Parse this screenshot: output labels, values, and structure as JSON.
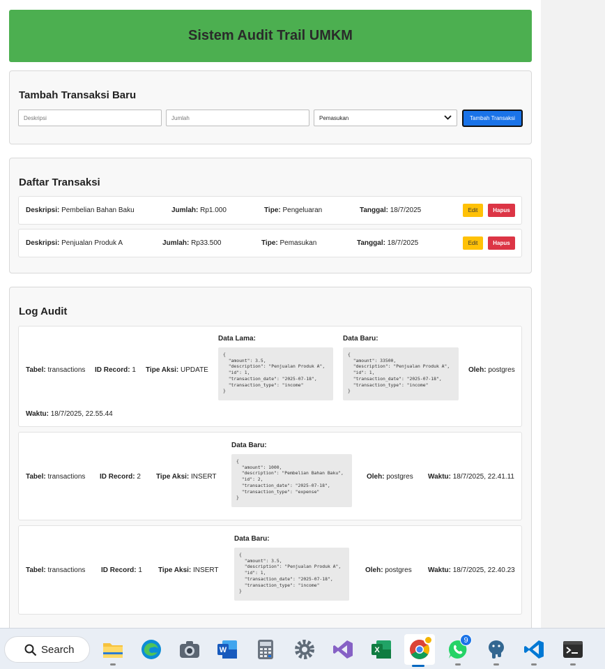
{
  "header": {
    "title": "Sistem Audit Trail UMKM"
  },
  "form": {
    "title": "Tambah Transaksi Baru",
    "description_placeholder": "Deskripsi",
    "amount_placeholder": "Jumlah",
    "type_selected": "Pemasukan",
    "submit_label": "Tambah Transaksi"
  },
  "transactions": {
    "title": "Daftar Transaksi",
    "labels": {
      "description": "Deskripsi:",
      "amount": "Jumlah:",
      "type": "Tipe:",
      "date": "Tanggal:",
      "edit": "Edit",
      "delete": "Hapus"
    },
    "items": [
      {
        "description": "Pembelian Bahan Baku",
        "amount": "Rp1.000",
        "type": "Pengeluaran",
        "date": "18/7/2025"
      },
      {
        "description": "Penjualan Produk A",
        "amount": "Rp33.500",
        "type": "Pemasukan",
        "date": "18/7/2025"
      }
    ]
  },
  "audit": {
    "title": "Log Audit",
    "labels": {
      "table": "Tabel:",
      "record": "ID Record:",
      "action": "Tipe Aksi:",
      "old": "Data Lama:",
      "new": "Data Baru:",
      "by": "Oleh:",
      "time": "Waktu:"
    },
    "items": [
      {
        "table": "transactions",
        "record": "1",
        "action": "UPDATE",
        "old_data": "{\n  \"amount\": 3.5,\n  \"description\": \"Penjualan Produk A\",\n  \"id\": 1,\n  \"transaction_date\": \"2025-07-18\",\n  \"transaction_type\": \"income\"\n}",
        "new_data": "{\n  \"amount\": 33500,\n  \"description\": \"Penjualan Produk A\",\n  \"id\": 1,\n  \"transaction_date\": \"2025-07-18\",\n  \"transaction_type\": \"income\"\n}",
        "by": "postgres",
        "time": "18/7/2025, 22.55.44"
      },
      {
        "table": "transactions",
        "record": "2",
        "action": "INSERT",
        "new_data": "{\n  \"amount\": 1000,\n  \"description\": \"Pembelian Bahan Baku\",\n  \"id\": 2,\n  \"transaction_date\": \"2025-07-18\",\n  \"transaction_type\": \"expense\"\n}",
        "by": "postgres",
        "time": "18/7/2025, 22.41.11"
      },
      {
        "table": "transactions",
        "record": "1",
        "action": "INSERT",
        "new_data": "{\n  \"amount\": 3.5,\n  \"description\": \"Penjualan Produk A\",\n  \"id\": 1,\n  \"transaction_date\": \"2025-07-18\",\n  \"transaction_type\": \"income\"\n}",
        "by": "postgres",
        "time": "18/7/2025, 22.40.23"
      }
    ]
  },
  "taskbar": {
    "search_label": "Search",
    "whatsapp_badge": "9",
    "apps": [
      "file-explorer-icon",
      "edge-icon",
      "camera-icon",
      "word-icon",
      "calculator-icon",
      "settings-icon",
      "visual-studio-icon",
      "excel-icon",
      "chrome-icon",
      "whatsapp-icon",
      "postgresql-icon",
      "vscode-icon",
      "terminal-icon"
    ]
  }
}
